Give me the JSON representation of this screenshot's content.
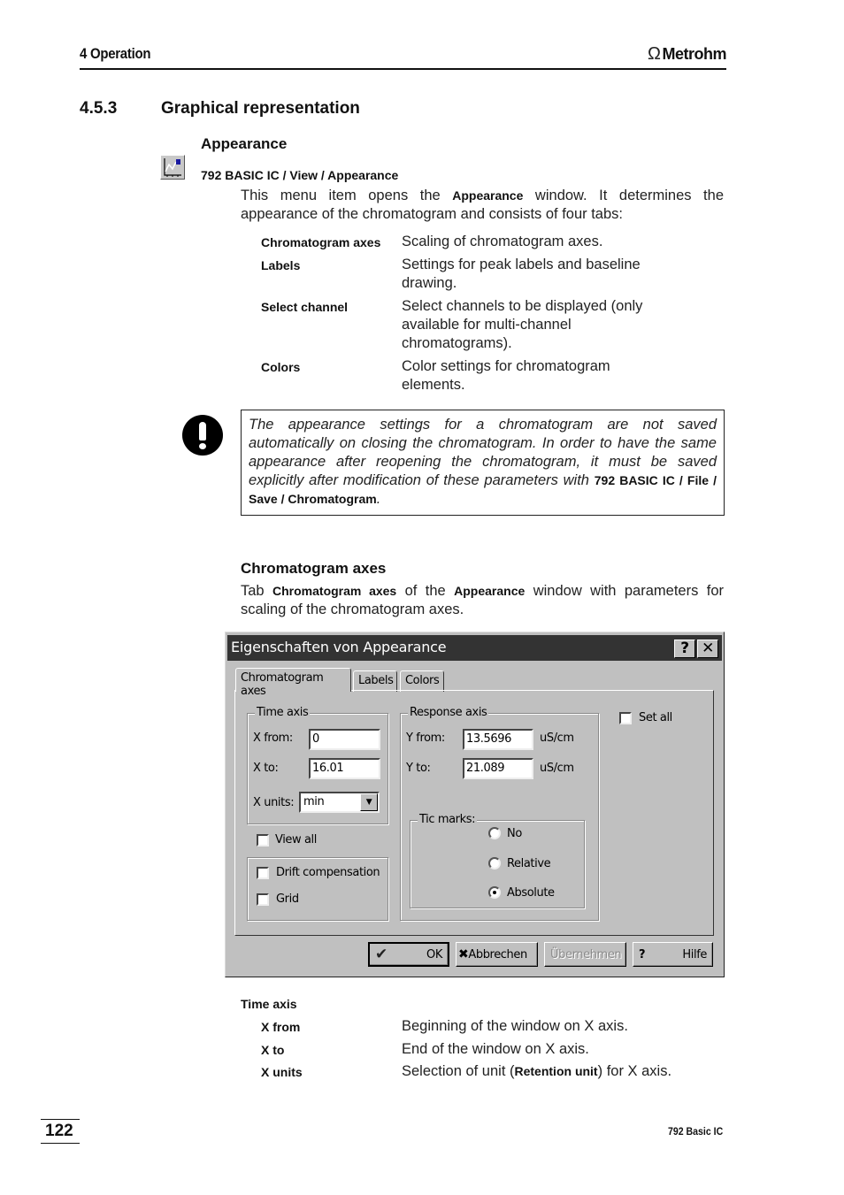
{
  "header": {
    "chapter": "4  Operation",
    "logo_text": "Metrohm",
    "logo_icon": "omega-icon"
  },
  "section": {
    "number": "4.5.3",
    "title": "Graphical representation"
  },
  "appearance": {
    "subtitle": "Appearance",
    "icon": "chart-toolbar-icon",
    "menu_path": "792 BASIC IC / View / Appearance",
    "intro_pre": "This menu item opens the ",
    "intro_bold": "Appearance",
    "intro_post": " window. It determines the appearance of the chromatogram and consists of four tabs:",
    "tabs_list": [
      {
        "term": "Chromatogram axes",
        "desc": "Scaling of chromatogram axes."
      },
      {
        "term": "Labels",
        "desc": "Settings for peak labels and baseline drawing."
      },
      {
        "term": "Select channel",
        "desc": "Select channels to be displayed (only available for multi-channel chromatograms)."
      },
      {
        "term": "Colors",
        "desc": "Color settings for chromatogram elements."
      }
    ]
  },
  "note": {
    "icon": "exclamation-icon",
    "text": "The appearance settings for a chromatogram are not saved automatically on closing the chromatogram. In order to have the same appearance after reopening the chromatogram, it must be saved explicitly after modification of these parameters with ",
    "path_bold": "792 BASIC IC / File / Save / Chromatogram",
    "end": "."
  },
  "chromatogram_axes": {
    "subtitle": "Chromatogram axes",
    "p_pre": "Tab ",
    "p_bold1": "Chromatogram axes",
    "p_mid": " of the ",
    "p_bold2": "Appearance",
    "p_post": " window with parameters for scaling of the chromatogram axes."
  },
  "dialog": {
    "title": "Eigenschaften von Appearance",
    "help_btn": "?",
    "close_btn": "✕",
    "tabs": [
      "Chromatogram axes",
      "Labels",
      "Colors"
    ],
    "active_tab": "Chromatogram axes",
    "time_axis": {
      "label": "Time axis",
      "x_from_label": "X from:",
      "x_from_value": "0",
      "x_to_label": "X to:",
      "x_to_value": "16.01",
      "x_units_label": "X units:",
      "x_units_value": "min"
    },
    "response_axis": {
      "label": "Response axis",
      "y_from_label": "Y from:",
      "y_from_value": "13.5696",
      "y_from_unit": "uS/cm",
      "y_to_label": "Y to:",
      "y_to_value": "21.089",
      "y_to_unit": "uS/cm"
    },
    "tic_marks": {
      "label": "Tic marks:",
      "options": [
        "No",
        "Relative",
        "Absolute"
      ],
      "selected": "Absolute"
    },
    "checkboxes": {
      "view_all": {
        "label": "View all",
        "checked": false
      },
      "drift_compensation": {
        "label": "Drift compensation",
        "checked": false
      },
      "grid": {
        "label": "Grid",
        "checked": false
      },
      "set_all": {
        "label": "Set all",
        "checked": false
      }
    },
    "buttons": {
      "ok": "OK",
      "cancel": "Abbrechen",
      "apply": "Übernehmen",
      "help": "Hilfe"
    }
  },
  "time_axis_list": {
    "heading": "Time axis",
    "rows": [
      {
        "term": "X from",
        "desc": "Beginning of the window on X axis."
      },
      {
        "term": "X to",
        "desc": "End of the window on X axis."
      },
      {
        "term": "X units",
        "desc_pre": "Selection of unit (",
        "desc_bold": "Retention unit",
        "desc_post": ") for X axis."
      }
    ]
  },
  "footer": {
    "page_number": "122",
    "product": "792 Basic IC"
  }
}
